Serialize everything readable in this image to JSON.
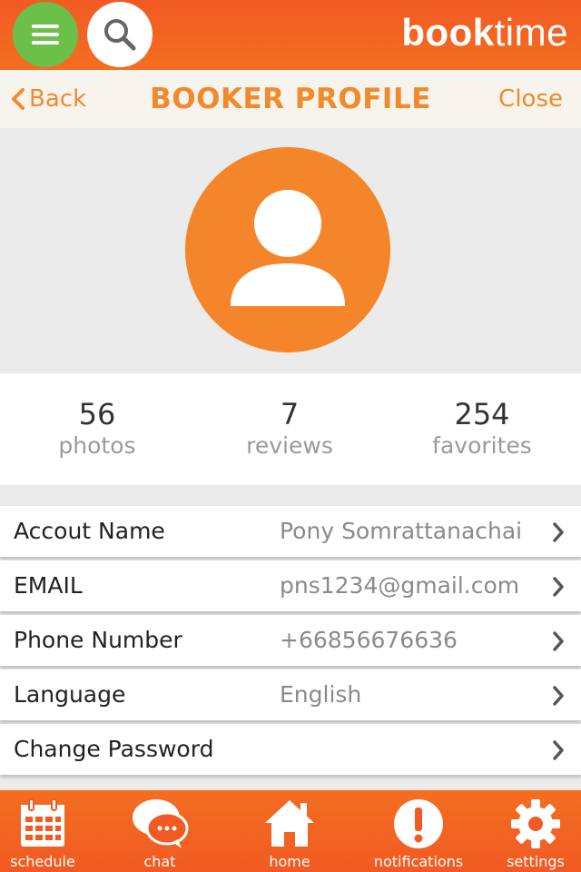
{
  "header": {
    "brand_bold": "book",
    "brand_light": "time"
  },
  "nav": {
    "back_label": "Back",
    "title": "BOOKER PROFILE",
    "close_label": "Close"
  },
  "stats": [
    {
      "value": "56",
      "label": "photos"
    },
    {
      "value": "7",
      "label": "reviews"
    },
    {
      "value": "254",
      "label": "favorites"
    }
  ],
  "rows": [
    {
      "label": "Accout Name",
      "value": "Pony Somrattanachai"
    },
    {
      "label": "EMAIL",
      "value": "pns1234@gmail.com"
    },
    {
      "label": "Phone Number",
      "value": "+66856676636"
    },
    {
      "label": "Language",
      "value": "English"
    },
    {
      "label": "Change Password",
      "value": ""
    }
  ],
  "tabs": [
    {
      "label": "schedule",
      "icon": "calendar-icon"
    },
    {
      "label": "chat",
      "icon": "chat-bubble-icon"
    },
    {
      "label": "home",
      "icon": "home-icon"
    },
    {
      "label": "notifications",
      "icon": "exclamation-icon"
    },
    {
      "label": "settings",
      "icon": "gear-icon"
    }
  ],
  "colors": {
    "accent_orange": "#f15a22",
    "text_orange": "#f28a2b",
    "menu_green": "#6cc04a",
    "avatar_orange": "#f5852a"
  }
}
